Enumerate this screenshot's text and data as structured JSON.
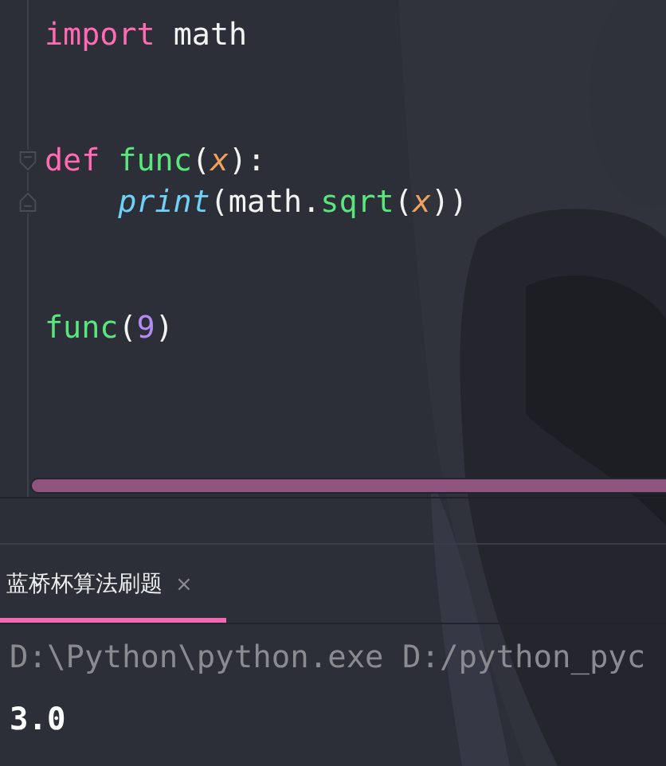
{
  "editor": {
    "lines": [
      {
        "kind": "code",
        "tokens": [
          {
            "kind": "keyword",
            "text": "import"
          },
          {
            "kind": "plain",
            "text": " math"
          }
        ]
      },
      {
        "kind": "blank"
      },
      {
        "kind": "blank"
      },
      {
        "kind": "fold_start",
        "tokens": [
          {
            "kind": "keyword",
            "text": "def"
          },
          {
            "kind": "space"
          },
          {
            "kind": "func",
            "text": "func"
          },
          {
            "kind": "plain",
            "text": "("
          },
          {
            "kind": "param",
            "text": "x"
          },
          {
            "kind": "plain",
            "text": "):"
          }
        ]
      },
      {
        "kind": "fold_end",
        "tokens": [
          {
            "kind": "indent"
          },
          {
            "kind": "builtin",
            "text": "print"
          },
          {
            "kind": "plain",
            "text": "(math."
          },
          {
            "kind": "func",
            "text": "sqrt"
          },
          {
            "kind": "plain",
            "text": "("
          },
          {
            "kind": "param",
            "text": "x"
          },
          {
            "kind": "plain",
            "text": "))"
          }
        ]
      },
      {
        "kind": "blank"
      },
      {
        "kind": "blank"
      },
      {
        "kind": "code",
        "tokens": [
          {
            "kind": "func",
            "text": "func"
          },
          {
            "kind": "plain",
            "text": "("
          },
          {
            "kind": "number",
            "text": "9"
          },
          {
            "kind": "plain",
            "text": ")"
          }
        ]
      }
    ]
  },
  "run_panel": {
    "tabs": [
      {
        "label": "蓝桥杯算法刷题",
        "selected": true,
        "close": "×"
      }
    ],
    "output": [
      {
        "kind": "command",
        "text": "D:\\Python\\python.exe D:/python_pyc"
      },
      {
        "kind": "result",
        "text": "3.0"
      }
    ]
  }
}
